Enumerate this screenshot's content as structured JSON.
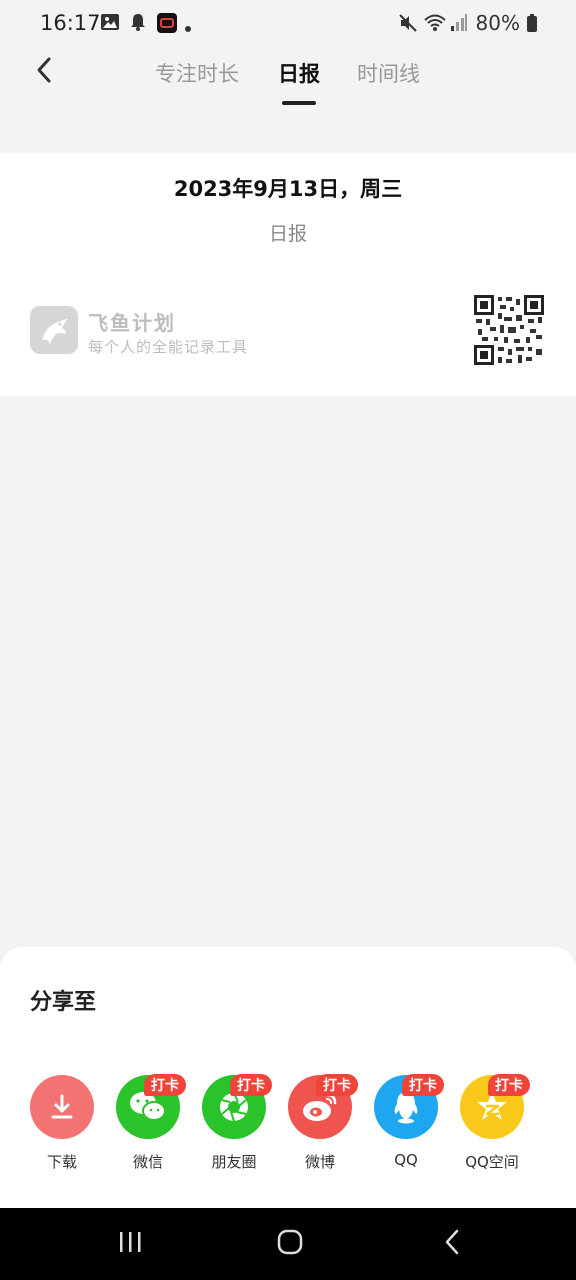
{
  "status_bar": {
    "time": "16:17",
    "battery": "80%",
    "left_icons": [
      "image-icon",
      "bell-icon",
      "screen-record-icon",
      "dot-icon"
    ],
    "right_icons": [
      "mute-icon",
      "wifi-icon",
      "signal-icon",
      "battery-icon"
    ]
  },
  "header": {
    "back_icon": "back-arrow-icon",
    "tabs": [
      {
        "label": "专注时长",
        "active": false
      },
      {
        "label": "日报",
        "active": true
      },
      {
        "label": "时间线",
        "active": false
      }
    ]
  },
  "report_card": {
    "date": "2023年9月13日，周三",
    "subtitle": "日报",
    "brand": {
      "name": "飞鱼计划",
      "slogan": "每个人的全能记录工具",
      "logo_icon": "flying-fish-logo"
    },
    "qr_icon": "qr-code"
  },
  "share_sheet": {
    "title": "分享至",
    "items": [
      {
        "label": "下载",
        "icon": "download-icon",
        "color": "#F37373",
        "badge": ""
      },
      {
        "label": "微信",
        "icon": "wechat-icon",
        "color": "#2BC32B",
        "badge": "打卡"
      },
      {
        "label": "朋友圈",
        "icon": "moments-icon",
        "color": "#2BC32B",
        "badge": "打卡"
      },
      {
        "label": "微博",
        "icon": "weibo-icon",
        "color": "#F0544E",
        "badge": "打卡"
      },
      {
        "label": "QQ",
        "icon": "qq-icon",
        "color": "#1EA7F0",
        "badge": "打卡"
      },
      {
        "label": "QQ空间",
        "icon": "qzone-icon",
        "color": "#F8C91B",
        "badge": "打卡"
      }
    ]
  },
  "nav_bar": {
    "buttons": [
      "recents-icon",
      "home-icon",
      "back-icon"
    ]
  },
  "colors": {
    "background": "#F2F3F5",
    "badge": "#F0433A",
    "active_tab": "#111111",
    "inactive_tab": "#999999"
  }
}
